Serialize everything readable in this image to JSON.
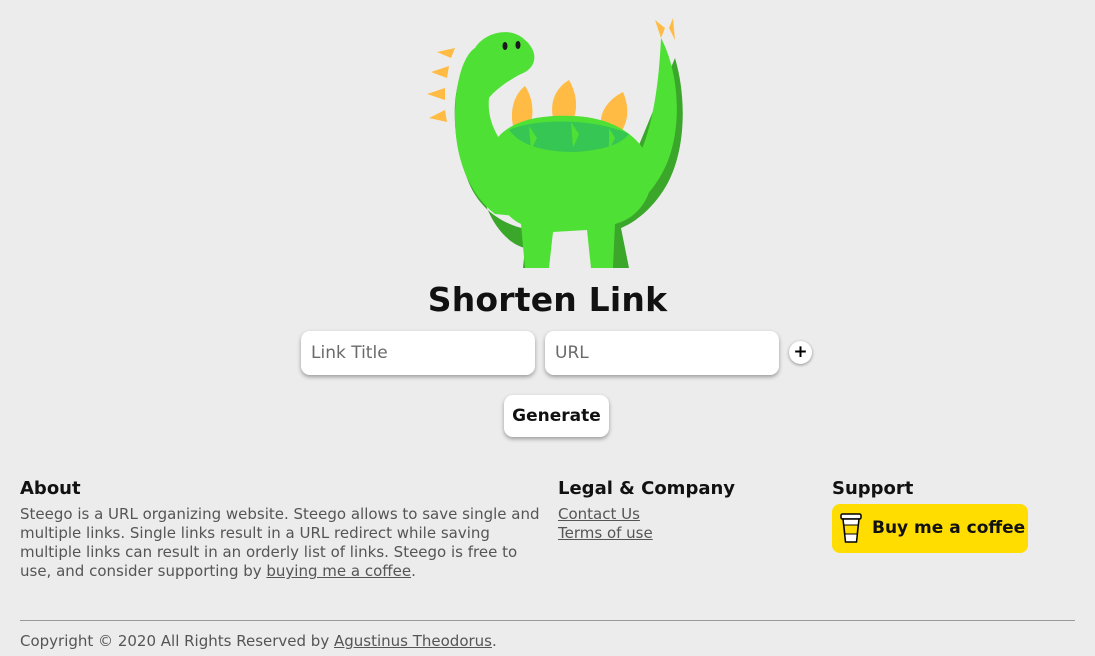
{
  "hero": {
    "logo_icon": "stegosaurus-dinosaur-icon",
    "title": "Shorten Link"
  },
  "form": {
    "title_placeholder": "Link Title",
    "url_placeholder": "URL",
    "add_label": "+",
    "generate_label": "Generate"
  },
  "footer": {
    "about": {
      "heading": "About",
      "text": "Steego is a URL organizing website. Steego allows to save single and multiple links. Single links result in a URL redirect while saving multiple links can result in an orderly list of links. Steego is free to use, and consider supporting by ",
      "link": "buying me a coffee",
      "suffix": "."
    },
    "legal": {
      "heading": "Legal & Company",
      "links": [
        "Contact Us",
        "Terms of use"
      ]
    },
    "support": {
      "heading": "Support",
      "button_label": "Buy me a coffee",
      "button_icon": "coffee-cup-icon",
      "button_color": "#ffdd00"
    },
    "copyright": {
      "text": "Copyright © 2020 All Rights Reserved by ",
      "author": "Agustinus Theodorus",
      "suffix": "."
    }
  },
  "colors": {
    "background": "#ececec",
    "dino_green": "#4fe035",
    "dino_dark_green": "#3aa62a",
    "dino_plates": "#ffbb44"
  }
}
